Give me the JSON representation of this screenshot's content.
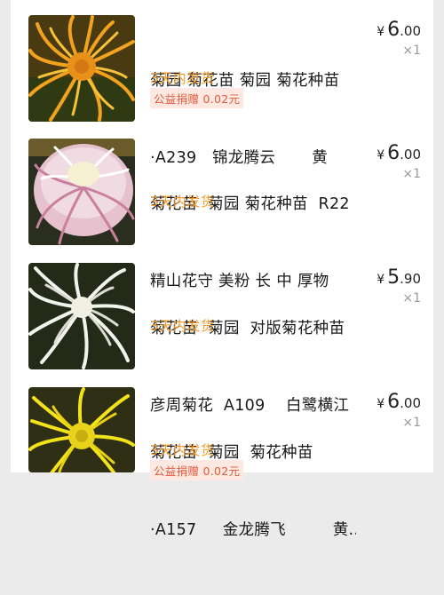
{
  "items": [
    {
      "title_line1": "菊园 菊花苗 菊园 菊花种苗",
      "title_line2": "·A239   锦龙腾云       黄",
      "price_currency": "¥",
      "price_int": "6",
      "price_dec": ".00",
      "quantity": "×1",
      "shipping": "3天内发货",
      "charity": "公益捐赠 0.02元",
      "image": "chrysanthemum-orange"
    },
    {
      "title_line1": "菊花苗  菊园 菊花种苗  R22",
      "title_line2": "精山花守 美粉 长 中 厚物",
      "price_currency": "¥",
      "price_int": "6",
      "price_dec": ".00",
      "quantity": "×1",
      "shipping": "3天内发货",
      "charity": "",
      "image": "chrysanthemum-pink"
    },
    {
      "title_line1": "菊花苗  菊园  对版菊花种苗",
      "title_line2": "彦周菊花  A109    白鹭横江",
      "price_currency": "¥",
      "price_int": "5",
      "price_dec": ".90",
      "quantity": "×1",
      "shipping": "3天内发货",
      "charity": "",
      "image": "chrysanthemum-white"
    },
    {
      "title_line1": "菊花苗  菊园  菊花种苗",
      "title_line2": "·A157     金龙腾飞         黄...",
      "price_currency": "¥",
      "price_int": "6",
      "price_dec": ".00",
      "quantity": "×1",
      "shipping": "3天内发货",
      "charity": "公益捐赠 0.02元",
      "image": "chrysanthemum-yellow"
    }
  ]
}
